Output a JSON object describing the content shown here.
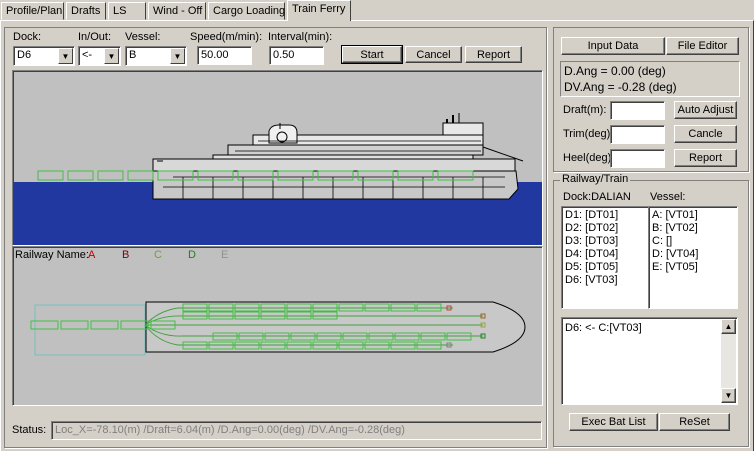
{
  "tabs": [
    {
      "label": "Profile/Plan"
    },
    {
      "label": "Drafts"
    },
    {
      "label": "LS"
    },
    {
      "label": "Wind - Off"
    },
    {
      "label": "Cargo Loading"
    },
    {
      "label": "Train Ferry"
    }
  ],
  "controls": {
    "dock_label": "Dock:",
    "dock_value": "D6",
    "inout_label": "In/Out:",
    "inout_value": "<-",
    "vessel_label": "Vessel:",
    "vessel_value": "B",
    "speed_label": "Speed(m/min):",
    "speed_value": "50.00",
    "interval_label": "Interval(min):",
    "interval_value": "0.50",
    "start": "Start",
    "cancel": "Cancel",
    "report": "Report"
  },
  "railway": {
    "label": "Railway Name:",
    "names": [
      {
        "name": "A",
        "color": "#c00000"
      },
      {
        "name": "B",
        "color": "#800000"
      },
      {
        "name": "C",
        "color": "#70a040"
      },
      {
        "name": "D",
        "color": "#208020"
      },
      {
        "name": "E",
        "color": "#909090"
      }
    ]
  },
  "status": {
    "label": "Status:",
    "text": "Loc_X=-78.10(m) /Draft=6.04(m) /D.Ang=0.00(deg) /DV.Ang=-0.28(deg)"
  },
  "right": {
    "input_data": "Input Data",
    "file_editor": "File Editor",
    "d_ang": "D.Ang  =  0.00 (deg)",
    "dv_ang": "DV.Ang  =  -0.28 (deg)",
    "draft_label": "Draft(m):",
    "trim_label": "Trim(deg):",
    "heel_label": "Heel(deg):",
    "auto_adjust": "Auto Adjust",
    "cancel": "Cancle",
    "report": "Report"
  },
  "rail_train": {
    "title": "Railway/Train",
    "dock_header": "Dock:DALIAN",
    "vessel_header": "Vessel:",
    "dock_items": [
      "D1: [DT01]",
      "D2: [DT02]",
      "D3: [DT03]",
      "D4: [DT04]",
      "D5: [DT05]",
      "D6: [VT03]"
    ],
    "vessel_items": [
      "A: [VT01]",
      "B: [VT02]",
      "C: []",
      "D: [VT04]",
      "E: [VT05]"
    ],
    "batch_text": "D6: <- C:[VT03]",
    "exec": "Exec Bat List",
    "reset": "ReSet"
  },
  "colors": {
    "sea": "#2038a0",
    "panel": "#c0c0c0",
    "train": "#40c040"
  }
}
